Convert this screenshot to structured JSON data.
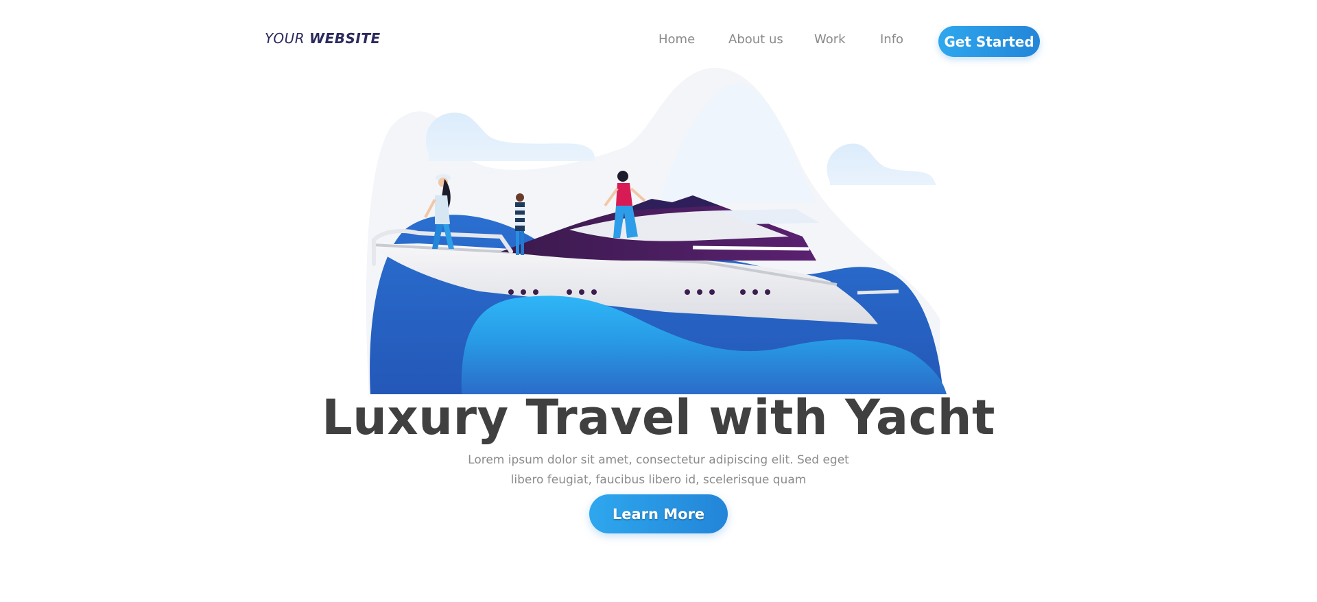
{
  "brand": {
    "logo_light": "YOUR",
    "logo_bold": "WEBSITE",
    "logo_color": "#2c2a5e"
  },
  "nav": {
    "items": [
      {
        "label": "Home"
      },
      {
        "label": "About us"
      },
      {
        "label": "Work"
      },
      {
        "label": "Info"
      }
    ],
    "cta_label": "Get Started"
  },
  "hero": {
    "illustration_icon": "yacht-illustration",
    "title": "Luxury Travel with Yacht",
    "description": "Lorem ipsum dolor sit amet, consectetur adipiscing elit. Sed eget libero feugiat, faucibus libero id, scelerisque quam",
    "cta_label": "Learn More"
  },
  "colors": {
    "accent_start": "#2ea7ee",
    "accent_end": "#2385d8",
    "title": "#404040",
    "text_muted": "#8c8c8c"
  }
}
